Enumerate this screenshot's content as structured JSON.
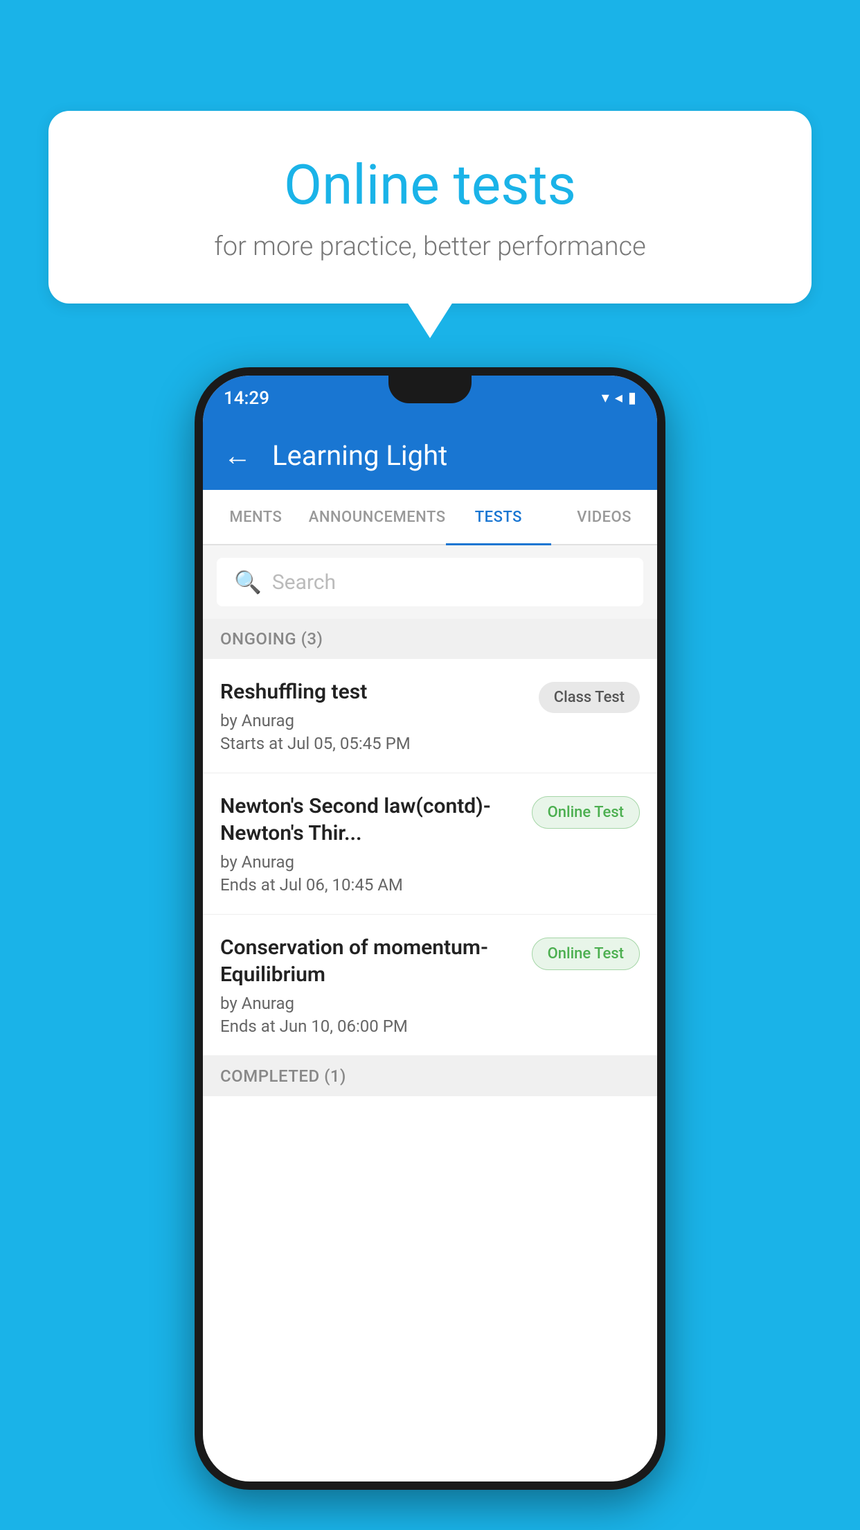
{
  "background": {
    "color": "#1ab3e8"
  },
  "speech_bubble": {
    "title": "Online tests",
    "subtitle": "for more practice, better performance"
  },
  "phone": {
    "status_bar": {
      "time": "14:29",
      "icons": "▾◂▮"
    },
    "app_bar": {
      "title": "Learning Light",
      "back_label": "←"
    },
    "tabs": [
      {
        "label": "MENTS",
        "active": false
      },
      {
        "label": "ANNOUNCEMENTS",
        "active": false
      },
      {
        "label": "TESTS",
        "active": true
      },
      {
        "label": "VIDEOS",
        "active": false
      }
    ],
    "search": {
      "placeholder": "Search"
    },
    "ongoing_section": {
      "label": "ONGOING (3)"
    },
    "tests": [
      {
        "name": "Reshuffling test",
        "author": "by Anurag",
        "time_label": "Starts at",
        "time": "Jul 05, 05:45 PM",
        "badge": "Class Test",
        "badge_type": "class"
      },
      {
        "name": "Newton's Second law(contd)-Newton's Thir...",
        "author": "by Anurag",
        "time_label": "Ends at",
        "time": "Jul 06, 10:45 AM",
        "badge": "Online Test",
        "badge_type": "online"
      },
      {
        "name": "Conservation of momentum-Equilibrium",
        "author": "by Anurag",
        "time_label": "Ends at",
        "time": "Jun 10, 06:00 PM",
        "badge": "Online Test",
        "badge_type": "online"
      }
    ],
    "completed_section": {
      "label": "COMPLETED (1)"
    }
  }
}
